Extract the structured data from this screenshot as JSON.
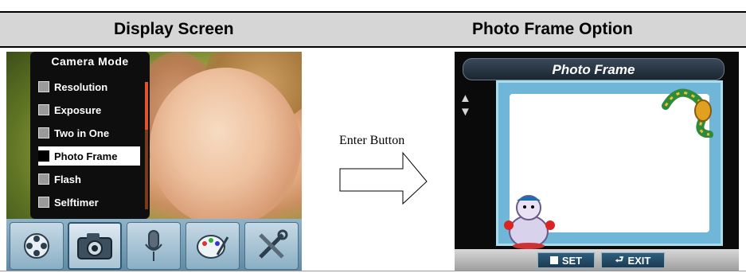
{
  "header": {
    "left_title": "Display Screen",
    "right_title": "Photo Frame Option"
  },
  "left_screen": {
    "menu_title": "Camera Mode",
    "items": [
      {
        "label": "Resolution",
        "icon": "resolution-icon"
      },
      {
        "label": "Exposure",
        "icon": "exposure-icon"
      },
      {
        "label": "Two in One",
        "icon": "two-in-one-icon"
      },
      {
        "label": "Photo Frame",
        "icon": "photo-frame-icon",
        "selected": true
      },
      {
        "label": "Flash",
        "icon": "flash-icon"
      },
      {
        "label": "Selftimer",
        "icon": "selftimer-icon"
      }
    ],
    "toolbar": [
      {
        "icon": "film-reel-icon"
      },
      {
        "icon": "camera-icon",
        "active": true
      },
      {
        "icon": "microphone-icon"
      },
      {
        "icon": "palette-icon"
      },
      {
        "icon": "tools-icon"
      }
    ]
  },
  "arrow": {
    "label": "Enter Button"
  },
  "right_screen": {
    "title": "Photo Frame",
    "set_label": "SET",
    "exit_label": "EXIT"
  },
  "colors": {
    "header_bg": "#d6d6d6",
    "selected_item_bg": "#ffffff",
    "frame_blue": "#6fb6d8"
  }
}
